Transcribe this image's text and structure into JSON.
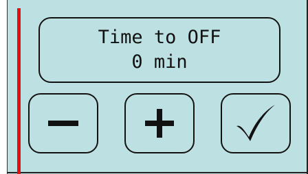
{
  "display": {
    "title": "Time to OFF",
    "value": "0 min"
  },
  "buttons": {
    "decrement_icon": "minus-icon",
    "increment_icon": "plus-icon",
    "confirm_icon": "checkmark-icon"
  },
  "colors": {
    "screen_background": "#bde0e2",
    "accent_bar": "#e01010",
    "outline": "#111111"
  }
}
